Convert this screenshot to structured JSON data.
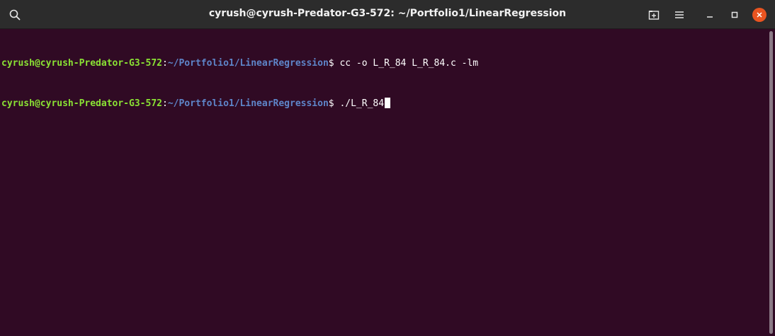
{
  "window": {
    "title": "cyrush@cyrush-Predator-G3-572: ~/Portfolio1/LinearRegression"
  },
  "titlebar_icons": {
    "search": "search-icon",
    "new_tab": "new-tab-icon",
    "menu": "hamburger-menu-icon",
    "minimize": "minimize-icon",
    "maximize": "maximize-icon",
    "close": "close-icon"
  },
  "terminal": {
    "lines": [
      {
        "user_host": "cyrush@cyrush-Predator-G3-572",
        "sep": ":",
        "path": "~/Portfolio1/LinearRegression",
        "prompt": "$ ",
        "command": "cc -o L_R_84 L_R_84.c -lm"
      },
      {
        "user_host": "cyrush@cyrush-Predator-G3-572",
        "sep": ":",
        "path": "~/Portfolio1/LinearRegression",
        "prompt": "$ ",
        "command": "./L_R_84"
      }
    ]
  },
  "colors": {
    "background": "#300a24",
    "titlebar": "#2c2c2c",
    "user_host": "#8ae234",
    "path": "#5e85c9",
    "close_button": "#e95420"
  }
}
